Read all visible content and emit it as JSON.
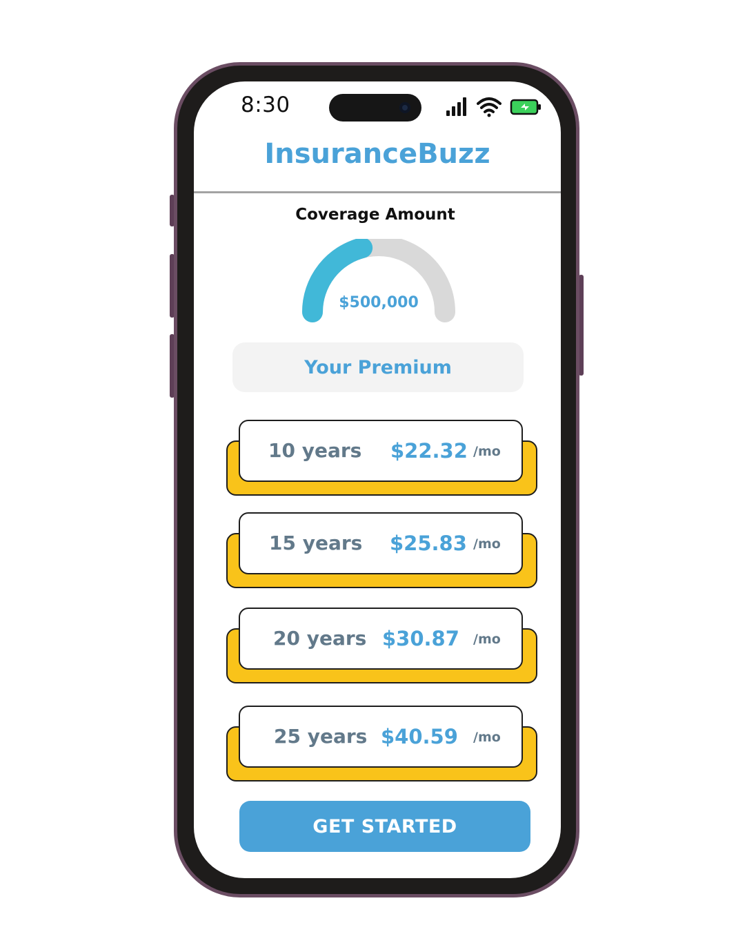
{
  "status_bar": {
    "time": "8:30",
    "icons": [
      "signal-icon",
      "wifi-icon",
      "battery-charging-icon"
    ]
  },
  "header": {
    "title": "InsuranceBuzz"
  },
  "coverage": {
    "label": "Coverage Amount",
    "value": "$500,000",
    "gauge_fill_fraction": 0.42,
    "fill_color": "#41b8d8",
    "track_color": "#d9d9d9"
  },
  "premium": {
    "heading": "Your Premium"
  },
  "plans": [
    {
      "term": "10 years",
      "price": "$22.32",
      "unit": "/mo"
    },
    {
      "term": "15 years",
      "price": "$25.83",
      "unit": "/mo"
    },
    {
      "term": "20 years",
      "price": "$30.87",
      "unit": "/mo"
    },
    {
      "term": "25 years",
      "price": "$40.59",
      "unit": "/mo"
    }
  ],
  "cta": {
    "label": "GET STARTED"
  },
  "colors": {
    "brand": "#4aa2d8",
    "card_accent": "#f9c31a",
    "phone_frame": "#6b4d63"
  }
}
